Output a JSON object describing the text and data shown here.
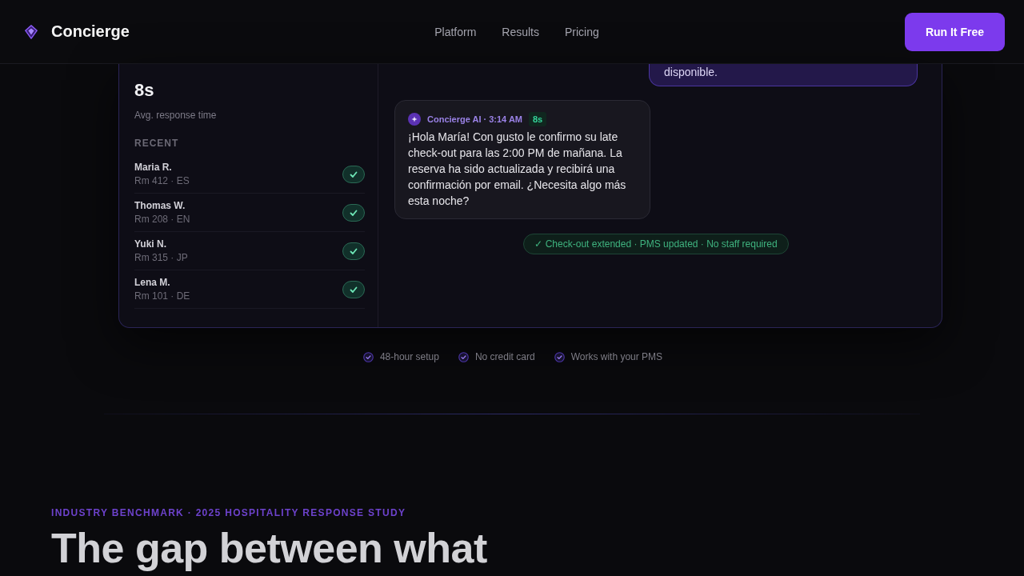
{
  "header": {
    "logo": "Concierge",
    "nav": [
      "Platform",
      "Results",
      "Pricing"
    ],
    "cta": "Run It Free"
  },
  "dashboard": {
    "stat": {
      "value": "8s",
      "label": "Avg. response time"
    },
    "recent_title": "RECENT",
    "guests": [
      {
        "name": "Maria R.",
        "detail": "Rm 412 · ES",
        "resolved": true
      },
      {
        "name": "Thomas W.",
        "detail": "Rm 208 · EN",
        "resolved": true
      },
      {
        "name": "Yuki N.",
        "detail": "Rm 315 · JP",
        "resolved": true
      },
      {
        "name": "Lena M.",
        "detail": "Rm 101 · DE",
        "resolved": true
      }
    ],
    "messages": [
      {
        "kind": "guest",
        "text": "disponible."
      },
      {
        "kind": "assistant",
        "sender": "Concierge AI · 3:14 AM",
        "badge": "8s",
        "text": "¡Hola María! Con gusto le confirmo su late check-out para las 2:00 PM de mañana. La reserva ha sido actualizada y recibirá una confirmación por email. ¿Necesita algo más esta noche?"
      }
    ],
    "status": "✓ Check-out extended · PMS updated · No staff required"
  },
  "perks": [
    "48-hour setup",
    "No credit card",
    "Works with your PMS"
  ],
  "benchmark": {
    "eyebrow": "INDUSTRY BENCHMARK · 2025 HOSPITALITY RESPONSE STUDY",
    "heading": "The gap between what"
  }
}
